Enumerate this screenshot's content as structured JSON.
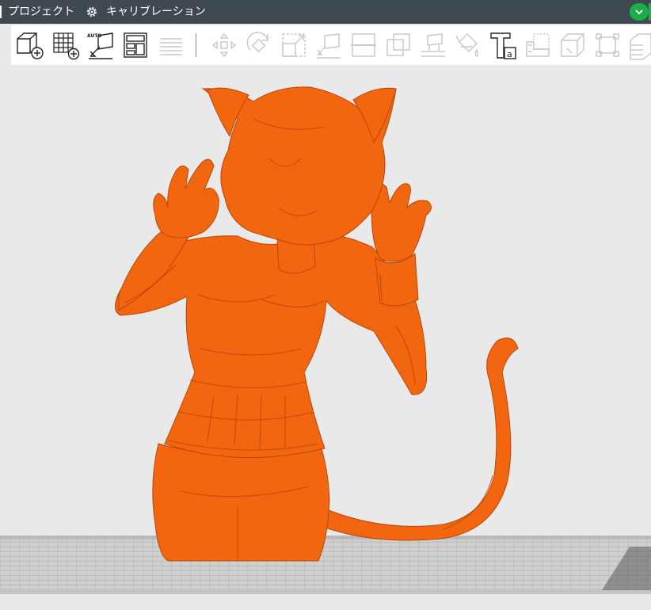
{
  "menu": {
    "project_label": "プロジェクト",
    "calibration_label": "キャリブレーション"
  },
  "toolbar": {
    "tools": [
      {
        "icon": "add-model-icon",
        "enabled": true
      },
      {
        "icon": "grid-array-icon",
        "enabled": true
      },
      {
        "icon": "auto-layout-icon",
        "enabled": true,
        "badge": "AUTO"
      },
      {
        "icon": "layout-panel-icon",
        "enabled": true
      },
      {
        "icon": "layers-icon",
        "enabled": false
      },
      {
        "icon": "move-icon",
        "enabled": false
      },
      {
        "icon": "rotate-icon",
        "enabled": false
      },
      {
        "icon": "scale-icon",
        "enabled": false
      },
      {
        "icon": "place-on-face-icon",
        "enabled": false
      },
      {
        "icon": "cut-icon",
        "enabled": false
      },
      {
        "icon": "boolean-icon",
        "enabled": false
      },
      {
        "icon": "support-paint-icon",
        "enabled": false
      },
      {
        "icon": "color-paint-icon",
        "enabled": false
      },
      {
        "icon": "text-tool-icon",
        "enabled": true,
        "badge": "a"
      },
      {
        "icon": "measure-icon",
        "enabled": false
      },
      {
        "icon": "assembly-icon",
        "enabled": false
      },
      {
        "icon": "fit-bounds-icon",
        "enabled": false
      },
      {
        "icon": "slice-layers-icon",
        "enabled": false
      }
    ]
  },
  "viewport": {
    "model_color": "#f2660f",
    "plate_color": "#cfcfcf",
    "background_color": "#e9e9e9"
  }
}
